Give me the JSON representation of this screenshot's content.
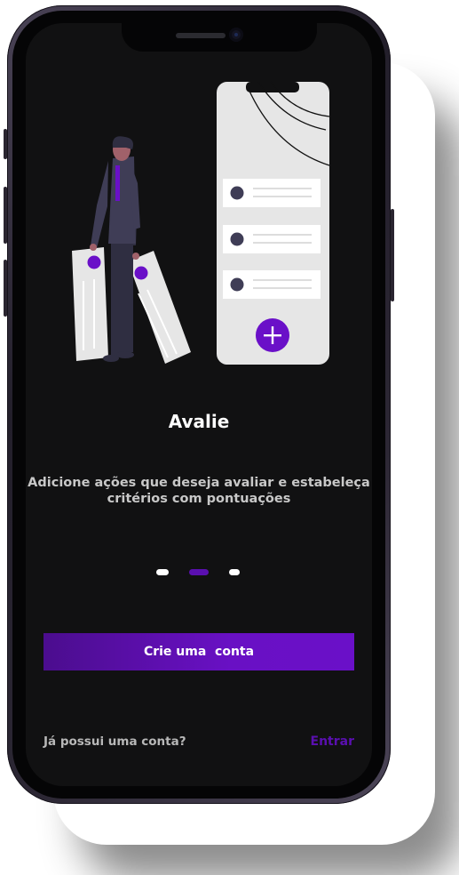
{
  "onboarding": {
    "title": "Avalie",
    "description": "Adicione ações que deseja avaliar e estabeleça critérios com pontuações",
    "pagination": {
      "current": 2,
      "total": 3
    }
  },
  "actions": {
    "create_account": "Crie uma  conta",
    "has_account": "Já possui uma conta?",
    "login": "Entrar"
  },
  "colors": {
    "accent": "#6a10c8",
    "background": "#111112",
    "text": "#ffffff"
  }
}
